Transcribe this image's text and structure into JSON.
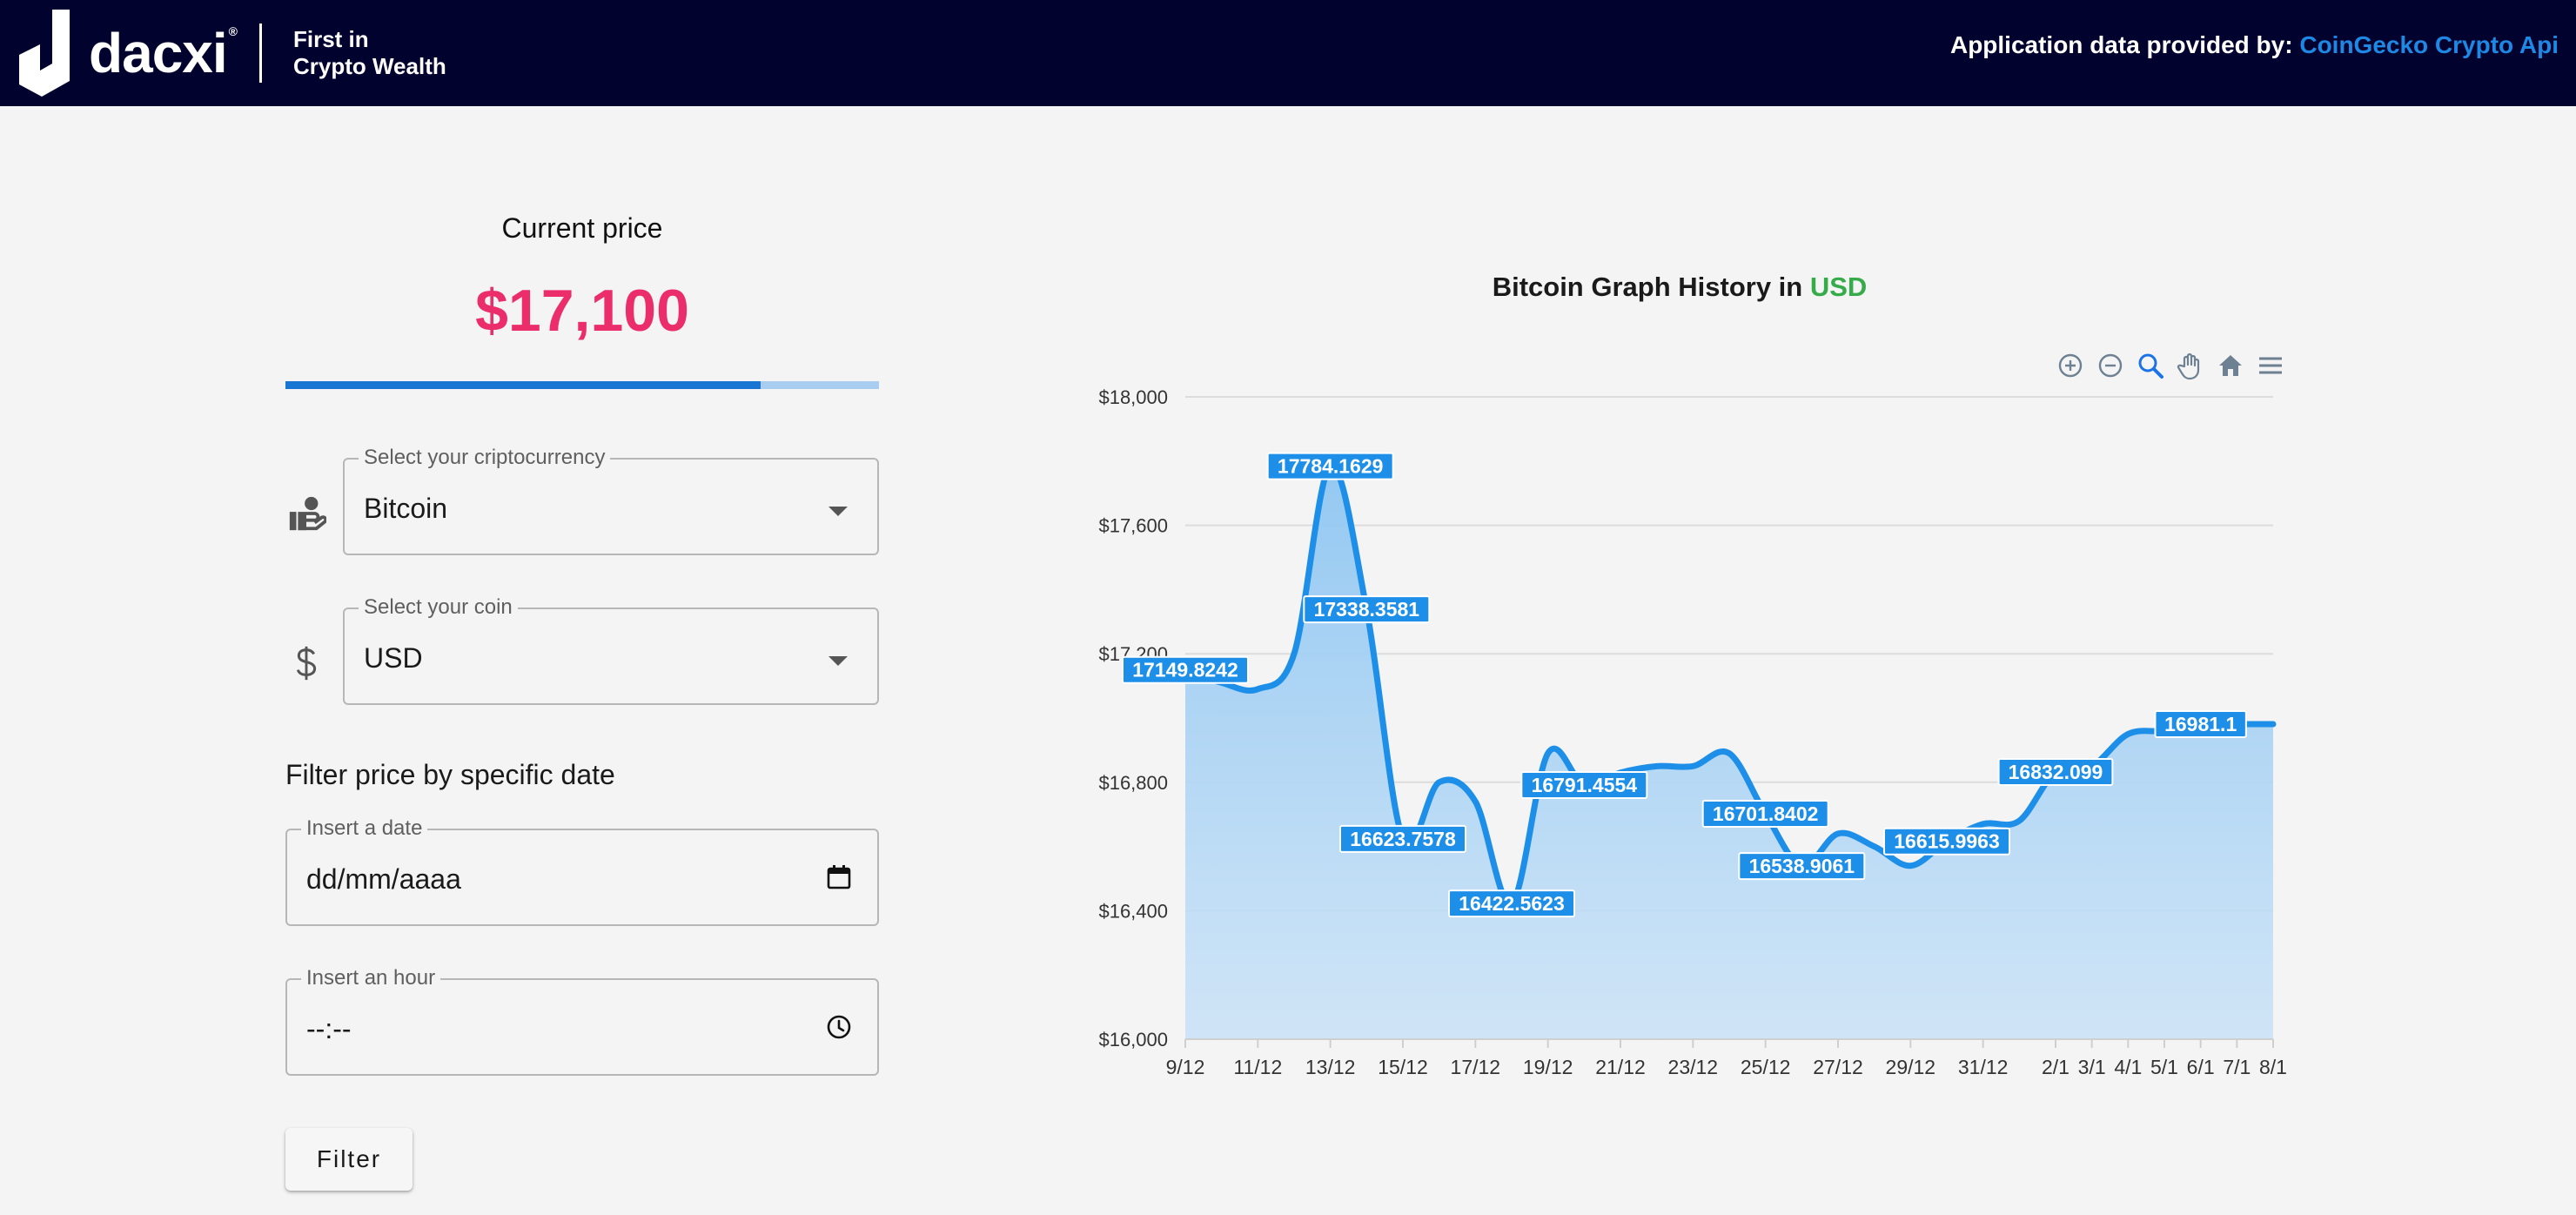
{
  "header": {
    "brand": "dacxi",
    "brand_mark": "®",
    "tagline_line1": "First in",
    "tagline_line2": "Crypto Wealth",
    "credit_prefix": "Application data provided by:",
    "credit_link": "CoinGecko Crypto Api"
  },
  "price_panel": {
    "label": "Current price",
    "value": "$17,100",
    "progress": 0.8
  },
  "form": {
    "crypto": {
      "legend": "Select your criptocurrency",
      "value": "Bitcoin",
      "icon": "hand-coin-icon"
    },
    "coin": {
      "legend": "Select your coin",
      "value": "USD",
      "icon": "dollar-icon"
    },
    "filter_title": "Filter price by specific date",
    "date": {
      "legend": "Insert a date",
      "placeholder": "dd/mm/aaaa",
      "icon": "calendar-icon"
    },
    "hour": {
      "legend": "Insert an hour",
      "placeholder": "--:--",
      "icon": "clock-icon"
    },
    "filter_button": "Filter"
  },
  "chart": {
    "title_prefix": "Bitcoin Graph History in",
    "title_currency": "USD",
    "toolbar": [
      "zoom-in-icon",
      "zoom-out-icon",
      "zoom-selection-icon",
      "pan-hand-icon",
      "reset-home-icon",
      "menu-icon"
    ]
  },
  "colors": {
    "header_bg": "#02022e",
    "price": "#ec2d6b",
    "accent_blue": "#1976d2",
    "series": "#1e8fe9",
    "currency_green": "#36ab4a",
    "credit_link": "#1e88e5"
  },
  "chart_data": {
    "type": "area",
    "ylim": [
      16000,
      18000
    ],
    "y_ticks": [
      "$16,000",
      "$16,400",
      "$16,800",
      "$17,200",
      "$17,600",
      "$18,000"
    ],
    "y_tick_values": [
      16000,
      16400,
      16800,
      17200,
      17600,
      18000
    ],
    "grid": "horizontal",
    "x_tick_labels": [
      "9/12",
      "11/12",
      "13/12",
      "15/12",
      "17/12",
      "19/12",
      "21/12",
      "23/12",
      "25/12",
      "27/12",
      "29/12",
      "31/12",
      "2/1",
      "3/1",
      "4/1",
      "5/1",
      "6/1",
      "7/1",
      "8/1"
    ],
    "x": [
      "9/12",
      "10/12",
      "11/12",
      "12/12",
      "13/12",
      "14/12",
      "15/12",
      "16/12",
      "17/12",
      "18/12",
      "19/12",
      "20/12",
      "21/12",
      "22/12",
      "23/12",
      "24/12",
      "25/12",
      "26/12",
      "27/12",
      "28/12",
      "29/12",
      "30/12",
      "31/12",
      "1/1",
      "2/1",
      "3/1",
      "4/1",
      "5/1",
      "6/1",
      "7/1",
      "8/1"
    ],
    "values": [
      17149.8242,
      17110,
      17090,
      17200,
      17784.1629,
      17338.3581,
      16623.7578,
      16800,
      16740,
      16422.5623,
      16890,
      16791.4554,
      16830,
      16850,
      16850,
      16890,
      16701.8402,
      16538.9061,
      16640,
      16600,
      16540,
      16615.9963,
      16670,
      16680,
      16832.099,
      16850,
      16950,
      16960,
      16981.1,
      16981.1,
      16981.1
    ],
    "data_labels": [
      "17149.8242",
      "",
      "",
      "",
      "17784.1629",
      "17338.3581",
      "16623.7578",
      "",
      "",
      "16422.5623",
      "",
      "16791.4554",
      "",
      "",
      "",
      "",
      "16701.8402",
      "16538.9061",
      "",
      "",
      "",
      "16615.9963",
      "",
      "",
      "16832.099",
      "",
      "",
      "",
      "16981.1"
    ],
    "title": "Bitcoin Graph History in USD"
  }
}
